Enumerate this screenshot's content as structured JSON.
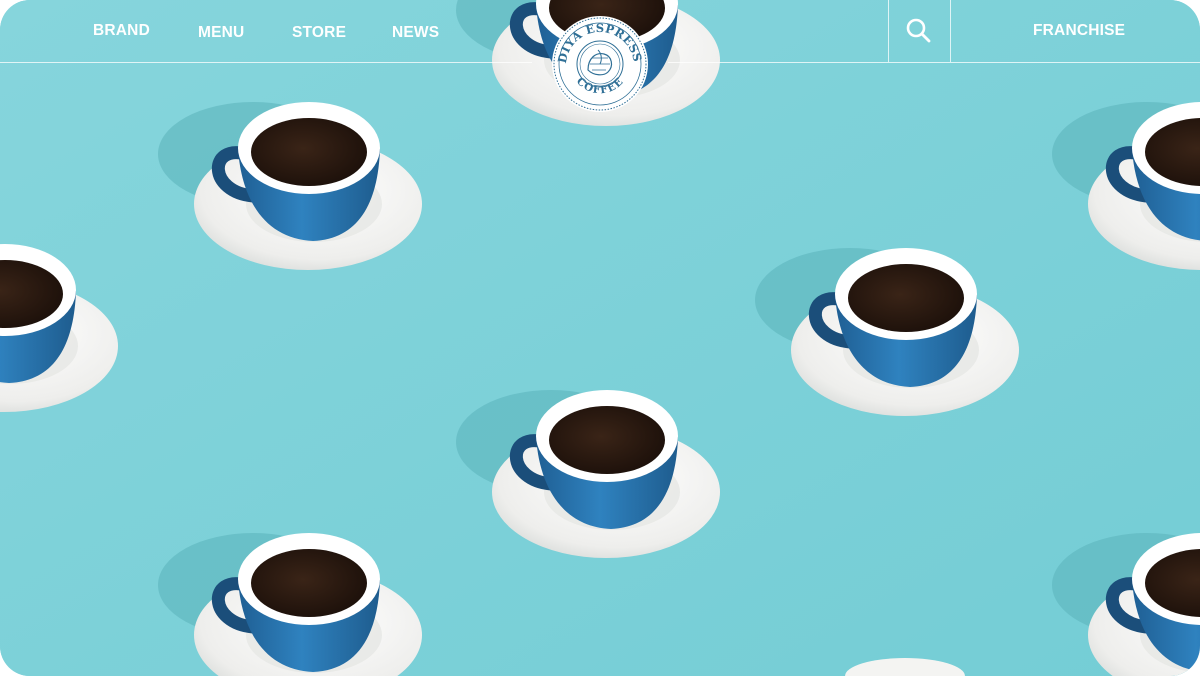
{
  "nav": {
    "brand": "BRAND",
    "menu": "MENU",
    "store": "STORE",
    "news": "NEWS",
    "franchise": "FRANCHISE"
  },
  "logo": {
    "top_text": "EDIYA ESPRESSO",
    "bottom_text": "COFFEE"
  },
  "icons": {
    "search": "search-icon"
  },
  "colors": {
    "background": "#7fd2d9",
    "cup_blue": "#2a78b4",
    "saucer": "#f4f4f2",
    "coffee": "#2b1a10",
    "nav_text": "#ffffff",
    "logo_ink": "#2f6f96"
  }
}
